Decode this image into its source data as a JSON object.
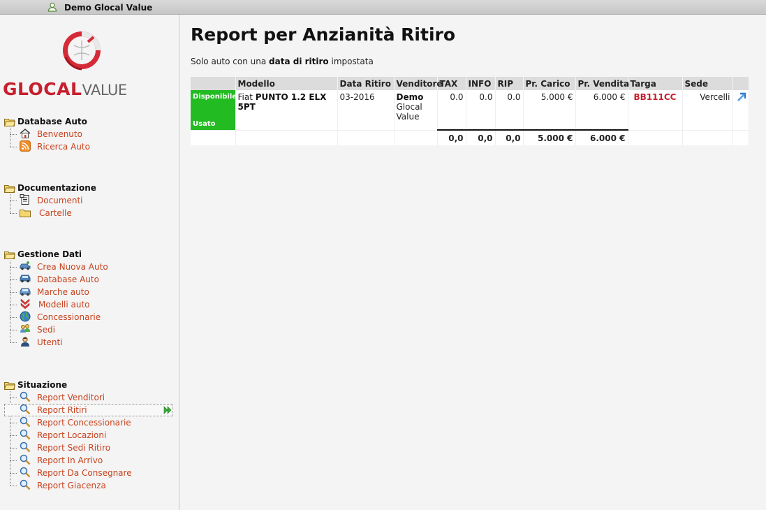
{
  "topbar": {
    "user_name": "Demo Glocal Value"
  },
  "logo": {
    "glocal": "GLOCAL",
    "value": "VALUE"
  },
  "sidebar": {
    "sections": [
      {
        "title": "Database Auto",
        "items": [
          "Benvenuto",
          "Ricerca Auto"
        ]
      },
      {
        "title": "Documentazione",
        "items": [
          "Documenti",
          "Cartelle"
        ]
      },
      {
        "title": "Gestione Dati",
        "items": [
          "Crea Nuova Auto",
          "Database Auto",
          "Marche auto",
          "Modelli auto",
          "Concessionarie",
          "Sedi",
          "Utenti"
        ]
      },
      {
        "title": "Situazione",
        "items": [
          "Report Venditori",
          "Report Ritiri",
          "Report Concessionarie",
          "Report Locazioni",
          "Report Sedi Ritiro",
          "Report In Arrivo",
          "Report Da Consegnare",
          "Report Giacenza"
        ]
      }
    ],
    "active_item": "Report Ritiri"
  },
  "main": {
    "title": "Report per Anzianità Ritiro",
    "subtitle_pre": "Solo auto con una",
    "subtitle_bold": "data di ritiro",
    "subtitle_post": "impostata",
    "columns": [
      "",
      "Modello",
      "Data Ritiro",
      "Venditore",
      "TAX",
      "INFO",
      "RIP",
      "Pr. Carico",
      "Pr. Vendita",
      "Targa",
      "Sede",
      ""
    ],
    "row": {
      "status_top": "Disponibile",
      "status_bottom": "Usato",
      "make": "Fiat",
      "model": "PUNTO 1.2 ELX 5PT",
      "date": "03-2016",
      "seller_1": "Demo",
      "seller_2": "Glocal",
      "seller_3": "Value",
      "tax": "0.0",
      "info": "0.0",
      "rip": "0.0",
      "load_price": "5.000 €",
      "sale_price": "6.000 €",
      "plate": "BB111CC",
      "site": "Vercelli"
    },
    "totals": {
      "tax": "0,0",
      "info": "0,0",
      "rip": "0,0",
      "load_price": "5.000 €",
      "sale_price": "6.000 €"
    }
  },
  "colors": {
    "accent": "#c8421e",
    "status_green": "#22bb22",
    "plate_red": "#c41e2e"
  }
}
